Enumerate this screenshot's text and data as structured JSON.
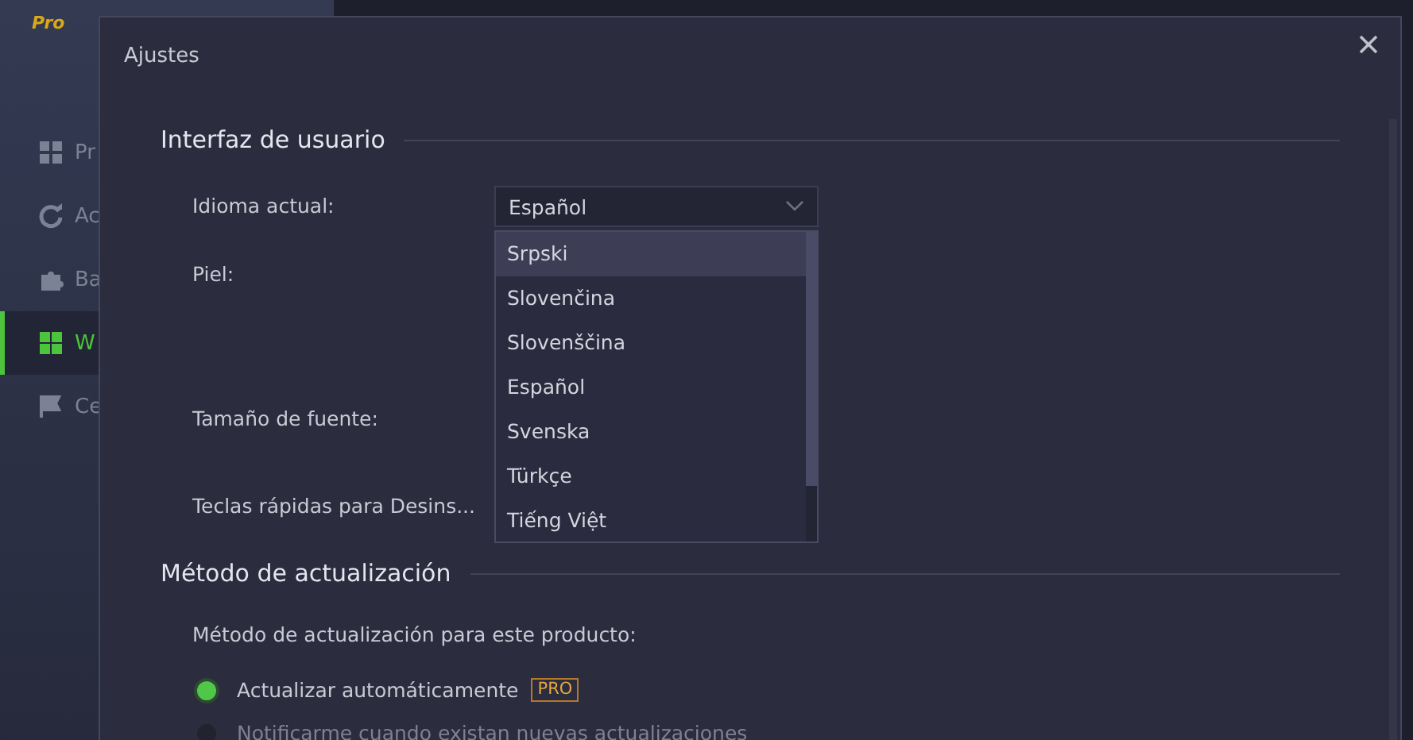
{
  "app": {
    "edition": "Pro",
    "sidebar": {
      "items": [
        {
          "label": "Pr",
          "kind": "grid",
          "selected": false
        },
        {
          "label": "Ac",
          "kind": "refresh",
          "selected": false
        },
        {
          "label": "Ba",
          "kind": "puzzle",
          "selected": false
        },
        {
          "label": "W",
          "kind": "windows",
          "selected": true
        },
        {
          "label": "Ce",
          "kind": "flag",
          "selected": false
        }
      ]
    }
  },
  "dialog": {
    "title": "Ajustes",
    "sections": [
      {
        "title": "Interfaz de usuario",
        "rows": [
          {
            "kind": "select",
            "label": "Idioma actual:",
            "value": "Español",
            "open": true,
            "options": [
              {
                "label": "Srpski",
                "highlighted": true
              },
              {
                "label": "Slovenčina",
                "highlighted": false
              },
              {
                "label": "Slovenščina",
                "highlighted": false
              },
              {
                "label": "Español",
                "highlighted": false
              },
              {
                "label": "Svenska",
                "highlighted": false
              },
              {
                "label": "Türkçe",
                "highlighted": false
              },
              {
                "label": "Tiếng Việt",
                "highlighted": false
              }
            ]
          },
          {
            "kind": "blank",
            "label": "Piel:"
          },
          {
            "kind": "blank",
            "label": "Tamaño de fuente:"
          },
          {
            "kind": "blank",
            "label": "Teclas rápidas para Desins..."
          }
        ]
      },
      {
        "title": "Método de actualización",
        "rows": [
          {
            "kind": "text",
            "label": "Método de actualización para este producto:"
          },
          {
            "kind": "radio",
            "label": "Actualizar automáticamente",
            "badge": "PRO",
            "selected": true
          },
          {
            "kind": "radio",
            "label": "Notificarme cuando existan nuevas actualizaciones",
            "selected": false
          }
        ]
      }
    ]
  }
}
